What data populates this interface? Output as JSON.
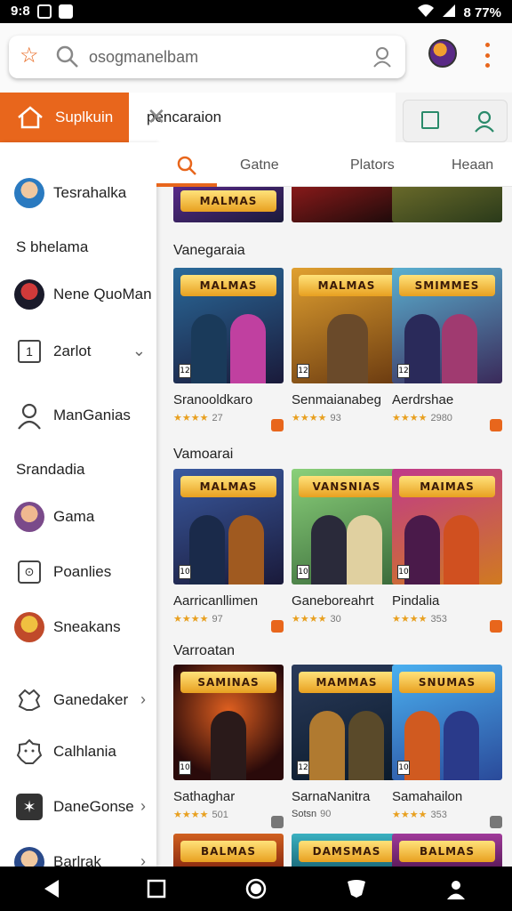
{
  "status_bar": {
    "time": "9:8",
    "right_text": "8 77%"
  },
  "search": {
    "placeholder": "osogmanelbam"
  },
  "secondary_bar": {
    "home_label": "Suplkuin",
    "query": "pencaraion"
  },
  "sidebar": {
    "profile_name": "Tesrahalka",
    "section1": "S bhelama",
    "items_a": [
      {
        "label": "Nene QuoMan",
        "icon": "game-avatar-icon"
      },
      {
        "label": "2arlot",
        "icon": "square-one-icon"
      },
      {
        "label": "ManGanias",
        "icon": "person-icon"
      }
    ],
    "section2": "Srandadia",
    "items_b": [
      {
        "label": "Gama",
        "icon": "user-avatar-icon"
      },
      {
        "label": "Poanlies",
        "icon": "gamepad-icon"
      },
      {
        "label": "Sneakans",
        "icon": "user-avatar-icon"
      },
      {
        "label": "Ganedaker",
        "icon": "puzzle-icon"
      },
      {
        "label": "Calhlania",
        "icon": "smile-icon"
      },
      {
        "label": "DaneGonse",
        "icon": "star-icon"
      },
      {
        "label": "Barlrak",
        "icon": "user-avatar-icon"
      }
    ]
  },
  "tabs": {
    "t1": "Gatne",
    "t2": "Plators",
    "t3": "Heaan"
  },
  "sections": [
    {
      "title": "Vanegaraia",
      "cards": [
        {
          "name": "Sranooldkaro",
          "rating": "★★★★",
          "count": "27",
          "logo": "MALMAS",
          "age": "12",
          "bg": "#2a6a9a",
          "accent": "#c040a0"
        },
        {
          "name": "Senmaianabeg",
          "rating": "★★★★",
          "count": "93",
          "logo": "MALMAS",
          "age": "12",
          "bg": "#c07a20",
          "accent": "#6a4a2a"
        },
        {
          "name": "Aerdrshae",
          "rating": "★★★★",
          "count": "2980",
          "logo": "SMIMMES",
          "age": "12",
          "bg": "#3a8ab0",
          "accent": "#a03a70"
        }
      ]
    },
    {
      "title": "Vamoarai",
      "cards": [
        {
          "name": "Aarricanllimen",
          "rating": "★★★★",
          "count": "97",
          "logo": "MALMAS",
          "age": "10",
          "bg": "#2a4a8a",
          "accent": "#a05a20"
        },
        {
          "name": "Ganeboreahrt",
          "rating": "★★★★",
          "count": "30",
          "logo": "VANSNIAS",
          "age": "10",
          "bg": "#4a9a5a",
          "accent": "#2a2a3a"
        },
        {
          "name": "Pindalia",
          "rating": "★★★★",
          "count": "353",
          "logo": "MAIMAS",
          "age": "10",
          "bg": "#9a3a7a",
          "accent": "#d05020"
        }
      ]
    },
    {
      "title": "Varroatan",
      "cards": [
        {
          "name": "Sathaghar",
          "rating": "★★★★",
          "count": "501",
          "logo": "SAMINAS",
          "age": "10",
          "bg": "#8a2a1a",
          "accent": "#2a1a1a"
        },
        {
          "name": "SarnaNanitra",
          "rating": "Sotsn",
          "count": "90",
          "logo": "MAMMAS",
          "age": "12",
          "bg": "#2a3a5a",
          "accent": "#b07a30"
        },
        {
          "name": "Samahailon",
          "rating": "★★★★",
          "count": "353",
          "logo": "SNUMAS",
          "age": "10",
          "bg": "#2a8ad0",
          "accent": "#d05a20"
        }
      ]
    }
  ],
  "nav": {
    "back": "back-icon",
    "home": "home-icon",
    "recents": "recents-icon"
  }
}
